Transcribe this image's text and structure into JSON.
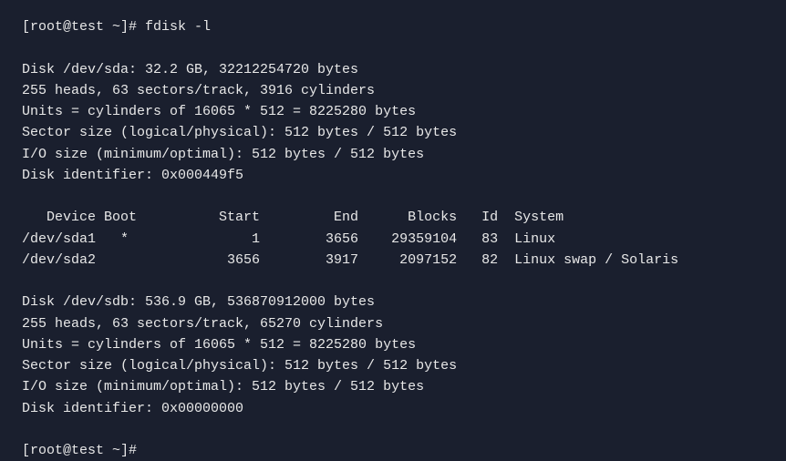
{
  "terminal": {
    "prompt_start": "[root@test ~]# fdisk -l",
    "prompt_end": "[root@test ~]#",
    "sda_section": {
      "line1": "Disk /dev/sda: 32.2 GB, 32212254720 bytes",
      "line2": "255 heads, 63 sectors/track, 3916 cylinders",
      "line3": "Units = cylinders of 16065 * 512 = 8225280 bytes",
      "line4": "Sector size (logical/physical): 512 bytes / 512 bytes",
      "line5": "I/O size (minimum/optimal): 512 bytes / 512 bytes",
      "line6": "Disk identifier: 0x000449f5"
    },
    "table_header": "   Device Boot          Start         End      Blocks   Id  System",
    "table_row1": "/dev/sda1   *               1        3656    29359104   83  Linux",
    "table_row2": "/dev/sda2                3656        3917     2097152   82  Linux swap / Solaris",
    "sdb_section": {
      "line1": "Disk /dev/sdb: 536.9 GB, 536870912000 bytes",
      "line2": "255 heads, 63 sectors/track, 65270 cylinders",
      "line3": "Units = cylinders of 16065 * 512 = 8225280 bytes",
      "line4": "Sector size (logical/physical): 512 bytes / 512 bytes",
      "line5": "I/O size (minimum/optimal): 512 bytes / 512 bytes",
      "line6": "Disk identifier: 0x00000000"
    }
  }
}
